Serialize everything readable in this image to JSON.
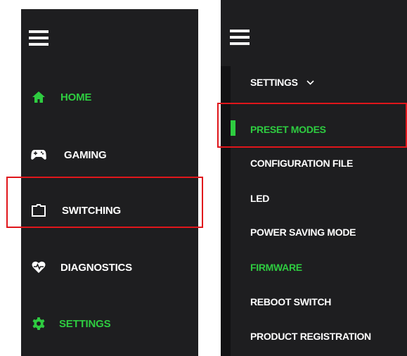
{
  "left_menu": {
    "items": [
      {
        "label": "HOME",
        "icon": "home-icon",
        "active": true
      },
      {
        "label": "GAMING",
        "icon": "gamepad-icon",
        "active": false
      },
      {
        "label": "SWITCHING",
        "icon": "switching-icon",
        "active": false
      },
      {
        "label": "DIAGNOSTICS",
        "icon": "heart-pulse-icon",
        "active": false
      },
      {
        "label": "SETTINGS",
        "icon": "gear-icon",
        "active": true
      }
    ]
  },
  "right_menu": {
    "section_label": "SETTINGS",
    "section_icon": "chevron-down-icon",
    "items": [
      {
        "label": "PRESET MODES",
        "active": true
      },
      {
        "label": "CONFIGURATION FILE",
        "active": false
      },
      {
        "label": "LED",
        "active": false
      },
      {
        "label": "POWER SAVING MODE",
        "active": false
      },
      {
        "label": "FIRMWARE",
        "active": true
      },
      {
        "label": "REBOOT SWITCH",
        "active": false
      },
      {
        "label": "PRODUCT REGISTRATION",
        "active": false
      }
    ]
  },
  "colors": {
    "panel_bg": "#1e1e20",
    "accent_green": "#2ecc40",
    "highlight_red": "#e0161b",
    "text_white": "#ffffff"
  }
}
